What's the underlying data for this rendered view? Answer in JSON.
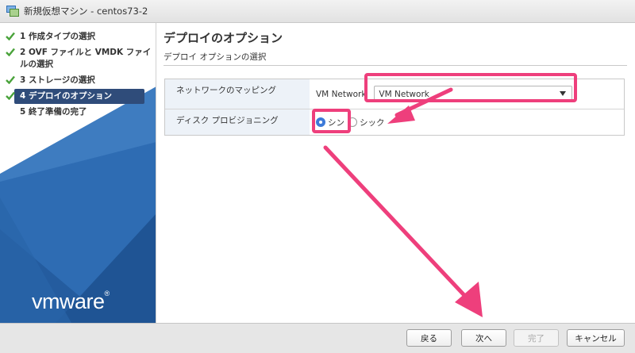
{
  "window": {
    "title": "新規仮想マシン - centos73-2"
  },
  "sidebar": {
    "steps": [
      {
        "label": "1 作成タイプの選択",
        "done": true
      },
      {
        "label": "2 OVF ファイルと VMDK ファイルの選択",
        "done": true
      },
      {
        "label": "3 ストレージの選択",
        "done": true
      },
      {
        "label": "4 デプロイのオプション",
        "done": true,
        "active": true
      },
      {
        "label": "5 終了準備の完了",
        "done": false
      }
    ],
    "logo": "vmware"
  },
  "main": {
    "title": "デプロイのオプション",
    "subtitle": "デプロイ オプションの選択",
    "network": {
      "label": "ネットワークのマッピング",
      "source": "VM Network",
      "selected": "VM Network"
    },
    "disk": {
      "label": "ディスク プロビジョニング",
      "options": [
        "シン",
        "シック"
      ],
      "selected": "シン"
    }
  },
  "footer": {
    "back": "戻る",
    "next": "次へ",
    "finish": "完了",
    "cancel": "キャンセル"
  },
  "colors": {
    "accent": "#2f4c7a",
    "annotation": "#ee3f7c",
    "check": "#4aa33b"
  }
}
